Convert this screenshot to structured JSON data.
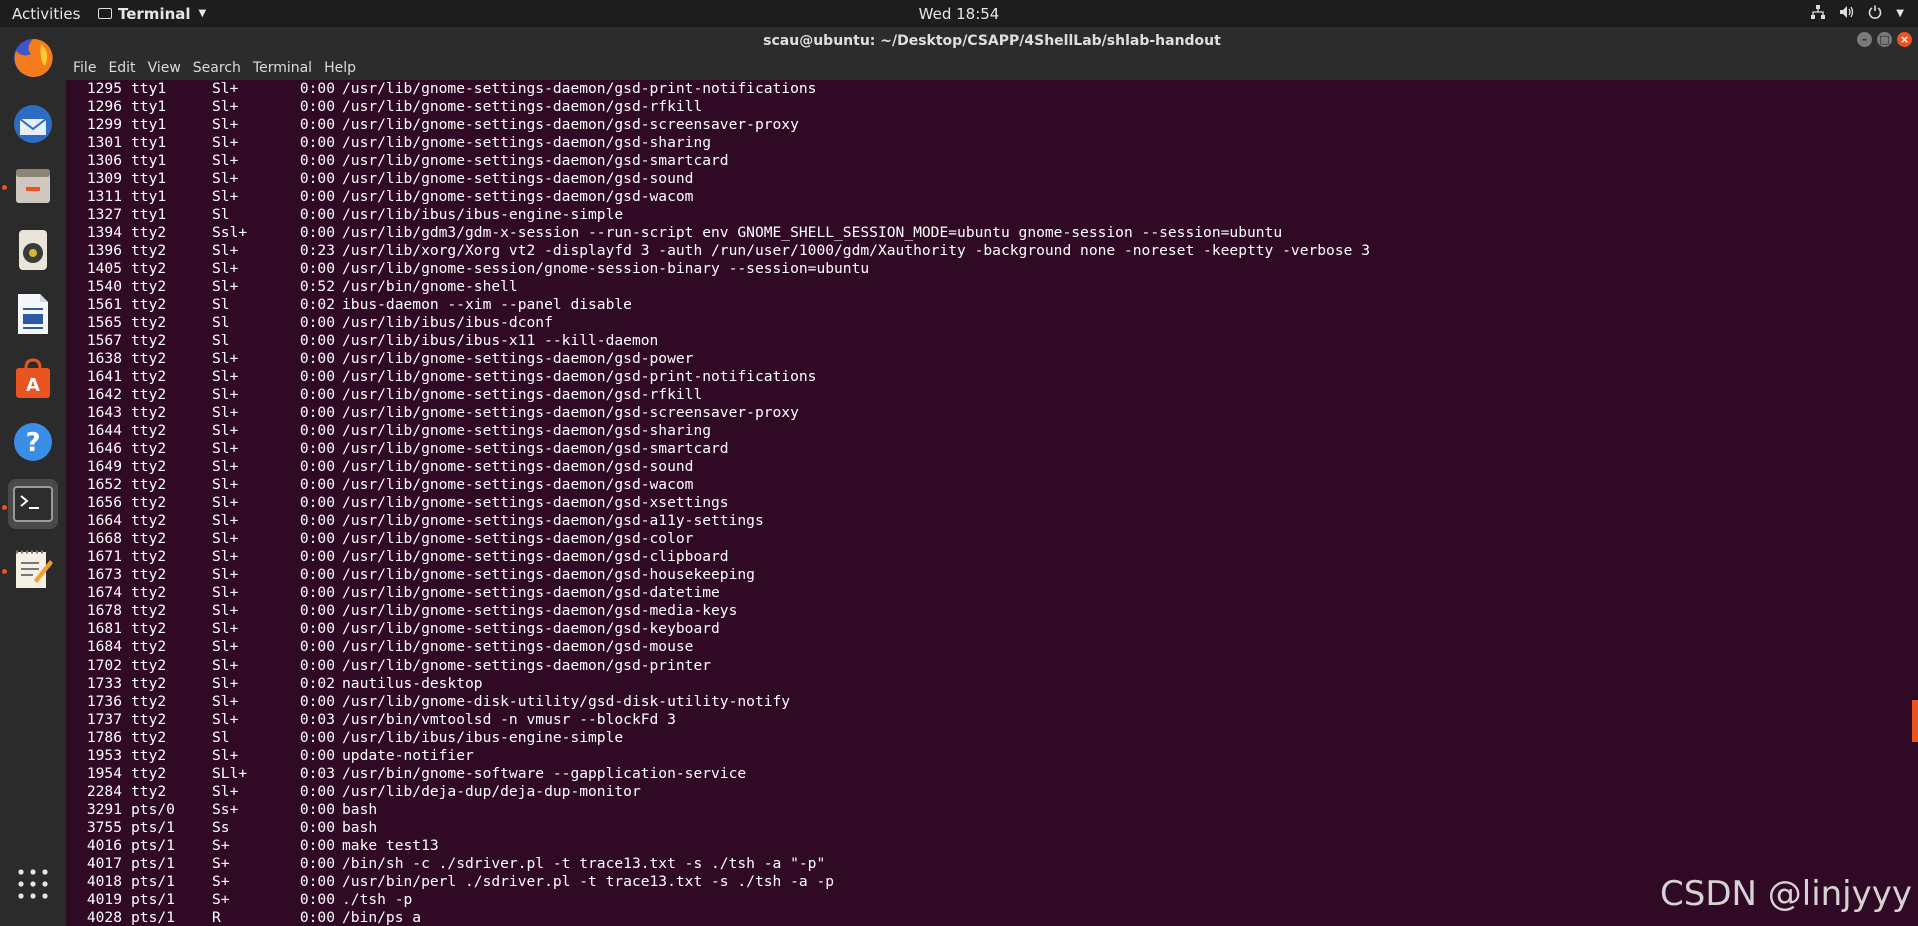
{
  "topbar": {
    "activities": "Activities",
    "app_name": "Terminal",
    "clock": "Wed 18:54"
  },
  "window": {
    "title": "scau@ubuntu: ~/Desktop/CSAPP/4ShellLab/shlab-handout"
  },
  "menu": [
    "File",
    "Edit",
    "View",
    "Search",
    "Terminal",
    "Help"
  ],
  "dock_apps": [
    {
      "name": "firefox-icon"
    },
    {
      "name": "thunderbird-icon"
    },
    {
      "name": "files-icon"
    },
    {
      "name": "rhythmbox-icon"
    },
    {
      "name": "libreoffice-writer-icon"
    },
    {
      "name": "software-center-icon"
    },
    {
      "name": "help-icon"
    },
    {
      "name": "terminal-icon"
    },
    {
      "name": "text-editor-icon"
    },
    {
      "name": "show-apps-icon"
    }
  ],
  "colors": {
    "terminal_bg": "#300a24",
    "accent": "#e95420"
  },
  "processes": [
    {
      "pid": "1295",
      "tty": "tty1",
      "stat": "Sl+",
      "time": "0:00",
      "cmd": "/usr/lib/gnome-settings-daemon/gsd-print-notifications"
    },
    {
      "pid": "1296",
      "tty": "tty1",
      "stat": "Sl+",
      "time": "0:00",
      "cmd": "/usr/lib/gnome-settings-daemon/gsd-rfkill"
    },
    {
      "pid": "1299",
      "tty": "tty1",
      "stat": "Sl+",
      "time": "0:00",
      "cmd": "/usr/lib/gnome-settings-daemon/gsd-screensaver-proxy"
    },
    {
      "pid": "1301",
      "tty": "tty1",
      "stat": "Sl+",
      "time": "0:00",
      "cmd": "/usr/lib/gnome-settings-daemon/gsd-sharing"
    },
    {
      "pid": "1306",
      "tty": "tty1",
      "stat": "Sl+",
      "time": "0:00",
      "cmd": "/usr/lib/gnome-settings-daemon/gsd-smartcard"
    },
    {
      "pid": "1309",
      "tty": "tty1",
      "stat": "Sl+",
      "time": "0:00",
      "cmd": "/usr/lib/gnome-settings-daemon/gsd-sound"
    },
    {
      "pid": "1311",
      "tty": "tty1",
      "stat": "Sl+",
      "time": "0:00",
      "cmd": "/usr/lib/gnome-settings-daemon/gsd-wacom"
    },
    {
      "pid": "1327",
      "tty": "tty1",
      "stat": "Sl",
      "time": "0:00",
      "cmd": "/usr/lib/ibus/ibus-engine-simple"
    },
    {
      "pid": "1394",
      "tty": "tty2",
      "stat": "Ssl+",
      "time": "0:00",
      "cmd": "/usr/lib/gdm3/gdm-x-session --run-script env GNOME_SHELL_SESSION_MODE=ubuntu gnome-session --session=ubuntu"
    },
    {
      "pid": "1396",
      "tty": "tty2",
      "stat": "Sl+",
      "time": "0:23",
      "cmd": "/usr/lib/xorg/Xorg vt2 -displayfd 3 -auth /run/user/1000/gdm/Xauthority -background none -noreset -keeptty -verbose 3"
    },
    {
      "pid": "1405",
      "tty": "tty2",
      "stat": "Sl+",
      "time": "0:00",
      "cmd": "/usr/lib/gnome-session/gnome-session-binary --session=ubuntu"
    },
    {
      "pid": "1540",
      "tty": "tty2",
      "stat": "Sl+",
      "time": "0:52",
      "cmd": "/usr/bin/gnome-shell"
    },
    {
      "pid": "1561",
      "tty": "tty2",
      "stat": "Sl",
      "time": "0:02",
      "cmd": "ibus-daemon --xim --panel disable"
    },
    {
      "pid": "1565",
      "tty": "tty2",
      "stat": "Sl",
      "time": "0:00",
      "cmd": "/usr/lib/ibus/ibus-dconf"
    },
    {
      "pid": "1567",
      "tty": "tty2",
      "stat": "Sl",
      "time": "0:00",
      "cmd": "/usr/lib/ibus/ibus-x11 --kill-daemon"
    },
    {
      "pid": "1638",
      "tty": "tty2",
      "stat": "Sl+",
      "time": "0:00",
      "cmd": "/usr/lib/gnome-settings-daemon/gsd-power"
    },
    {
      "pid": "1641",
      "tty": "tty2",
      "stat": "Sl+",
      "time": "0:00",
      "cmd": "/usr/lib/gnome-settings-daemon/gsd-print-notifications"
    },
    {
      "pid": "1642",
      "tty": "tty2",
      "stat": "Sl+",
      "time": "0:00",
      "cmd": "/usr/lib/gnome-settings-daemon/gsd-rfkill"
    },
    {
      "pid": "1643",
      "tty": "tty2",
      "stat": "Sl+",
      "time": "0:00",
      "cmd": "/usr/lib/gnome-settings-daemon/gsd-screensaver-proxy"
    },
    {
      "pid": "1644",
      "tty": "tty2",
      "stat": "Sl+",
      "time": "0:00",
      "cmd": "/usr/lib/gnome-settings-daemon/gsd-sharing"
    },
    {
      "pid": "1646",
      "tty": "tty2",
      "stat": "Sl+",
      "time": "0:00",
      "cmd": "/usr/lib/gnome-settings-daemon/gsd-smartcard"
    },
    {
      "pid": "1649",
      "tty": "tty2",
      "stat": "Sl+",
      "time": "0:00",
      "cmd": "/usr/lib/gnome-settings-daemon/gsd-sound"
    },
    {
      "pid": "1652",
      "tty": "tty2",
      "stat": "Sl+",
      "time": "0:00",
      "cmd": "/usr/lib/gnome-settings-daemon/gsd-wacom"
    },
    {
      "pid": "1656",
      "tty": "tty2",
      "stat": "Sl+",
      "time": "0:00",
      "cmd": "/usr/lib/gnome-settings-daemon/gsd-xsettings"
    },
    {
      "pid": "1664",
      "tty": "tty2",
      "stat": "Sl+",
      "time": "0:00",
      "cmd": "/usr/lib/gnome-settings-daemon/gsd-a11y-settings"
    },
    {
      "pid": "1668",
      "tty": "tty2",
      "stat": "Sl+",
      "time": "0:00",
      "cmd": "/usr/lib/gnome-settings-daemon/gsd-color"
    },
    {
      "pid": "1671",
      "tty": "tty2",
      "stat": "Sl+",
      "time": "0:00",
      "cmd": "/usr/lib/gnome-settings-daemon/gsd-clipboard"
    },
    {
      "pid": "1673",
      "tty": "tty2",
      "stat": "Sl+",
      "time": "0:00",
      "cmd": "/usr/lib/gnome-settings-daemon/gsd-housekeeping"
    },
    {
      "pid": "1674",
      "tty": "tty2",
      "stat": "Sl+",
      "time": "0:00",
      "cmd": "/usr/lib/gnome-settings-daemon/gsd-datetime"
    },
    {
      "pid": "1678",
      "tty": "tty2",
      "stat": "Sl+",
      "time": "0:00",
      "cmd": "/usr/lib/gnome-settings-daemon/gsd-media-keys"
    },
    {
      "pid": "1681",
      "tty": "tty2",
      "stat": "Sl+",
      "time": "0:00",
      "cmd": "/usr/lib/gnome-settings-daemon/gsd-keyboard"
    },
    {
      "pid": "1684",
      "tty": "tty2",
      "stat": "Sl+",
      "time": "0:00",
      "cmd": "/usr/lib/gnome-settings-daemon/gsd-mouse"
    },
    {
      "pid": "1702",
      "tty": "tty2",
      "stat": "Sl+",
      "time": "0:00",
      "cmd": "/usr/lib/gnome-settings-daemon/gsd-printer"
    },
    {
      "pid": "1733",
      "tty": "tty2",
      "stat": "Sl+",
      "time": "0:02",
      "cmd": "nautilus-desktop"
    },
    {
      "pid": "1736",
      "tty": "tty2",
      "stat": "Sl+",
      "time": "0:00",
      "cmd": "/usr/lib/gnome-disk-utility/gsd-disk-utility-notify"
    },
    {
      "pid": "1737",
      "tty": "tty2",
      "stat": "Sl+",
      "time": "0:03",
      "cmd": "/usr/bin/vmtoolsd -n vmusr --blockFd 3"
    },
    {
      "pid": "1786",
      "tty": "tty2",
      "stat": "Sl",
      "time": "0:00",
      "cmd": "/usr/lib/ibus/ibus-engine-simple"
    },
    {
      "pid": "1953",
      "tty": "tty2",
      "stat": "Sl+",
      "time": "0:00",
      "cmd": "update-notifier"
    },
    {
      "pid": "1954",
      "tty": "tty2",
      "stat": "SLl+",
      "time": "0:03",
      "cmd": "/usr/bin/gnome-software --gapplication-service"
    },
    {
      "pid": "2284",
      "tty": "tty2",
      "stat": "Sl+",
      "time": "0:00",
      "cmd": "/usr/lib/deja-dup/deja-dup-monitor"
    },
    {
      "pid": "3291",
      "tty": "pts/0",
      "stat": "Ss+",
      "time": "0:00",
      "cmd": "bash"
    },
    {
      "pid": "3755",
      "tty": "pts/1",
      "stat": "Ss",
      "time": "0:00",
      "cmd": "bash"
    },
    {
      "pid": "4016",
      "tty": "pts/1",
      "stat": "S+",
      "time": "0:00",
      "cmd": "make test13"
    },
    {
      "pid": "4017",
      "tty": "pts/1",
      "stat": "S+",
      "time": "0:00",
      "cmd": "/bin/sh -c ./sdriver.pl -t trace13.txt -s ./tsh -a \"-p\""
    },
    {
      "pid": "4018",
      "tty": "pts/1",
      "stat": "S+",
      "time": "0:00",
      "cmd": "/usr/bin/perl ./sdriver.pl -t trace13.txt -s ./tsh -a -p"
    },
    {
      "pid": "4019",
      "tty": "pts/1",
      "stat": "S+",
      "time": "0:00",
      "cmd": "./tsh -p"
    },
    {
      "pid": "4028",
      "tty": "pts/1",
      "stat": "R",
      "time": "0:00",
      "cmd": "/bin/ps a"
    }
  ],
  "watermark": "CSDN @linjyyy"
}
